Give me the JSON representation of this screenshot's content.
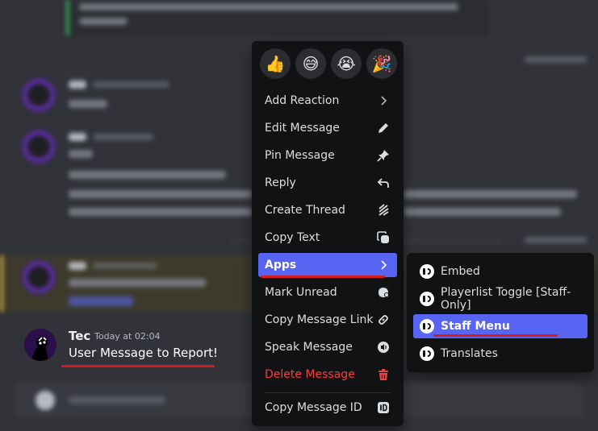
{
  "message": {
    "author": "Tec",
    "timestamp": "Today at 02:04",
    "content": "User Message to Report!"
  },
  "context_menu": {
    "reactions": [
      {
        "emoji": "👍",
        "icon": "thumbs-up"
      },
      {
        "emoji": "😅",
        "icon": "sweat-smile"
      },
      {
        "emoji": "😭",
        "icon": "loudly-crying"
      },
      {
        "emoji": "🎉",
        "icon": "party-popper"
      }
    ],
    "items": {
      "add_reaction": "Add Reaction",
      "edit_message": "Edit Message",
      "pin_message": "Pin Message",
      "reply": "Reply",
      "create_thread": "Create Thread",
      "copy_text": "Copy Text",
      "apps": "Apps",
      "mark_unread": "Mark Unread",
      "copy_message_link": "Copy Message Link",
      "speak_message": "Speak Message",
      "delete_message": "Delete Message",
      "copy_message_id": "Copy Message ID"
    }
  },
  "apps_submenu": {
    "items": [
      "Embed",
      "Playerlist Toggle [Staff-Only]",
      "Staff Menu",
      "Translates"
    ],
    "selected": "Staff Menu"
  },
  "colors": {
    "background": "#313338",
    "menu": "#111214",
    "accent": "#5865f2",
    "danger": "#f23f42",
    "annotation_underline": "#d21e1e"
  }
}
